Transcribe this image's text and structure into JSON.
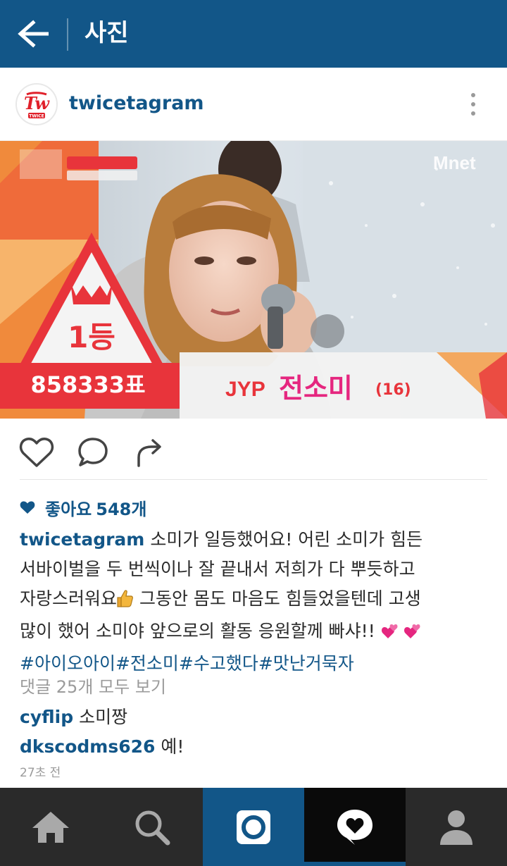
{
  "header": {
    "title": "사진"
  },
  "post": {
    "username": "twicetagram",
    "avatar_text": "TWICE",
    "photo": {
      "badge_rank": "1등",
      "badge_votes": "858333표",
      "agency": "JYP",
      "name": "전소미",
      "age": "(16)",
      "channel": "Mnet"
    },
    "likes": {
      "label": "좋아요",
      "count": "548개"
    },
    "caption": {
      "username": "twicetagram",
      "line1": "소미가 일등했어요! 어린 소미가 힘든",
      "line2": "서바이벌을 두 번씩이나 잘 끝내서 저희가 다 뿌듯하고",
      "line3a": "자랑스러워요",
      "line3b": " 그동안 몸도 마음도 힘들었을텐데 고생",
      "line4": "많이 했어 소미야 앞으로의 활동 응원할께 빠샤!!",
      "hashtags": "#아이오아이#전소미#수고했다#맛난거묵자"
    },
    "view_all_comments": "댓글 25개 모두 보기",
    "comments": [
      {
        "user": "cyflip",
        "text": "소미짱"
      },
      {
        "user": "dkscodms626",
        "text": "예!"
      }
    ],
    "timestamp": "27초 전"
  },
  "colors": {
    "brand": "#125688",
    "nav_bg": "#2a2a2a",
    "nav_active": "#0a0a0a",
    "badge_red": "#e8343b",
    "badge_orange": "#f07a2f",
    "heart_pink": "#e5267f"
  },
  "icons": [
    "back-arrow-icon",
    "more-vertical-icon",
    "heart-outline-icon",
    "comment-bubble-icon",
    "share-arrow-icon",
    "heart-filled-icon",
    "home-icon",
    "search-icon",
    "camera-icon",
    "activity-heart-icon",
    "profile-icon",
    "thumbs-up-emoji",
    "two-hearts-emoji"
  ]
}
